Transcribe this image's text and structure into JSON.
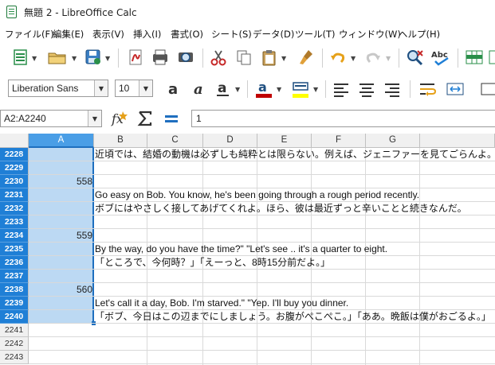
{
  "window": {
    "title": "無題 2 - LibreOffice Calc"
  },
  "menu": [
    "ファイル(F)",
    "編集(E)",
    "表示(V)",
    "挿入(I)",
    "書式(O)",
    "シート(S)",
    "データ(D)",
    "ツール(T)",
    "ウィンドウ(W)",
    "ヘルプ(H)"
  ],
  "format": {
    "font_name": "Liberation Sans",
    "font_size": "10"
  },
  "formula": {
    "name_box": "A2:A2240",
    "input": "1"
  },
  "columns": [
    "A",
    "B",
    "C",
    "D",
    "E",
    "F",
    "G"
  ],
  "selected_column": "A",
  "rows": [
    {
      "num": "2228",
      "a": "",
      "b": "近頃では、結婚の動機は必ずしも純粋とは限らない。例えば、ジェニファーを見てごらんよ。"
    },
    {
      "num": "2229",
      "a": "",
      "b": ""
    },
    {
      "num": "2230",
      "a": "558",
      "b": ""
    },
    {
      "num": "2231",
      "a": "",
      "b": "Go easy on Bob. You know, he's been going through a rough period recently."
    },
    {
      "num": "2232",
      "a": "",
      "b": "ボブにはやさしく接してあげてくれよ。ほら、彼は最近ずっと辛いことと続きなんだ。"
    },
    {
      "num": "2233",
      "a": "",
      "b": ""
    },
    {
      "num": "2234",
      "a": "559",
      "b": ""
    },
    {
      "num": "2235",
      "a": "",
      "b": "By the way, do you have the time?\" \"Let's see .. it's a quarter to eight."
    },
    {
      "num": "2236",
      "a": "",
      "b": "「ところで、今何時？」「えーっと、8時15分前だよ。」"
    },
    {
      "num": "2237",
      "a": "",
      "b": ""
    },
    {
      "num": "2238",
      "a": "560",
      "b": ""
    },
    {
      "num": "2239",
      "a": "",
      "b": "Let's call it a day, Bob. I'm starved.\" \"Yep. I'll buy you dinner."
    },
    {
      "num": "2240",
      "a": "",
      "b": "「ボブ、今日はこの辺までにしましょう。お腹がぺこぺこ。」「ああ。晩飯は僕がおごるよ。」"
    },
    {
      "num": "2241",
      "a": "",
      "b": ""
    },
    {
      "num": "2242",
      "a": "",
      "b": ""
    },
    {
      "num": "2243",
      "a": "",
      "b": ""
    }
  ],
  "selected_rows_count": 13,
  "colors": {
    "selection": "#bcd9f3",
    "selection_header": "#1f7fd6",
    "font_color_bar": "#c00000",
    "highlight_bar": "#ffff00"
  }
}
